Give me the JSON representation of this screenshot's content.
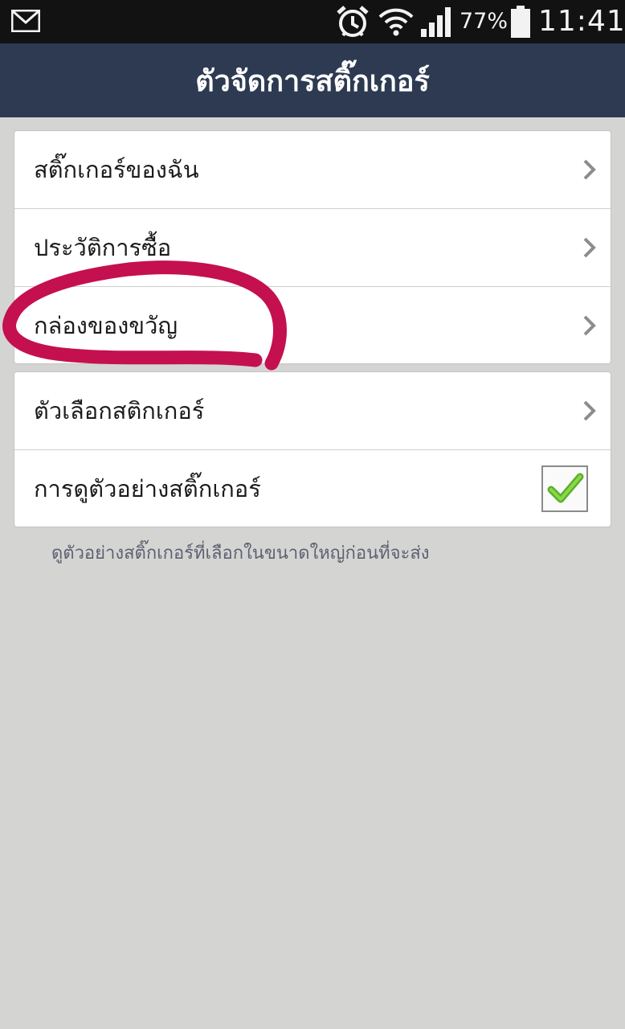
{
  "status_bar": {
    "battery_percent": "77%",
    "time": "11:41",
    "icons": [
      "gmail-icon",
      "alarm-icon",
      "wifi-icon",
      "signal-icon",
      "battery-icon"
    ]
  },
  "header": {
    "title": "ตัวจัดการสติ๊กเกอร์"
  },
  "menu": {
    "my_stickers": "สติ๊กเกอร์ของฉัน",
    "purchase_history": "ประวัติการซื้อ",
    "gift_box": "กล่องของขวัญ",
    "sticker_options": "ตัวเลือกสติกเกอร์",
    "sticker_preview": "การดูตัวอย่างสติ๊กเกอร์",
    "sticker_preview_checked": true,
    "sticker_preview_hint": "ดูตัวอย่างสติ๊กเกอร์ที่เลือกในขนาดใหญ่ก่อนที่จะส่ง"
  },
  "colors": {
    "header_bg": "#2d3a52",
    "status_bg": "#121212",
    "page_bg": "#d4d5d3",
    "annotation": "#c4104f",
    "check": "#6ec52e"
  }
}
